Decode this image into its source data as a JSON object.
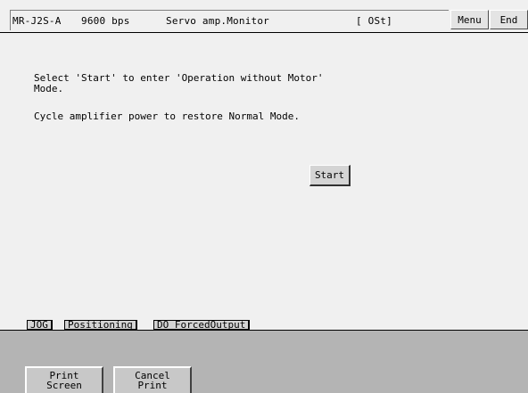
{
  "titlebar": {
    "model": "MR-J2S-A",
    "baud": "9600 bps",
    "mode": "Servo amp.Monitor",
    "status": "[ OSt]",
    "menu_label": "Menu",
    "end_label": "End"
  },
  "main": {
    "line1": "Select 'Start' to enter 'Operation without Motor'",
    "line2": "Mode.",
    "line3": "Cycle amplifier power to restore Normal Mode.",
    "start_label": "Start"
  },
  "tabs": [
    {
      "label": "JOG"
    },
    {
      "label": "Positioning"
    },
    {
      "label": "DO ForcedOutput"
    }
  ],
  "bottom": {
    "print_screen_label": "Print\nScreen",
    "cancel_print_label": "Cancel\nPrint"
  }
}
